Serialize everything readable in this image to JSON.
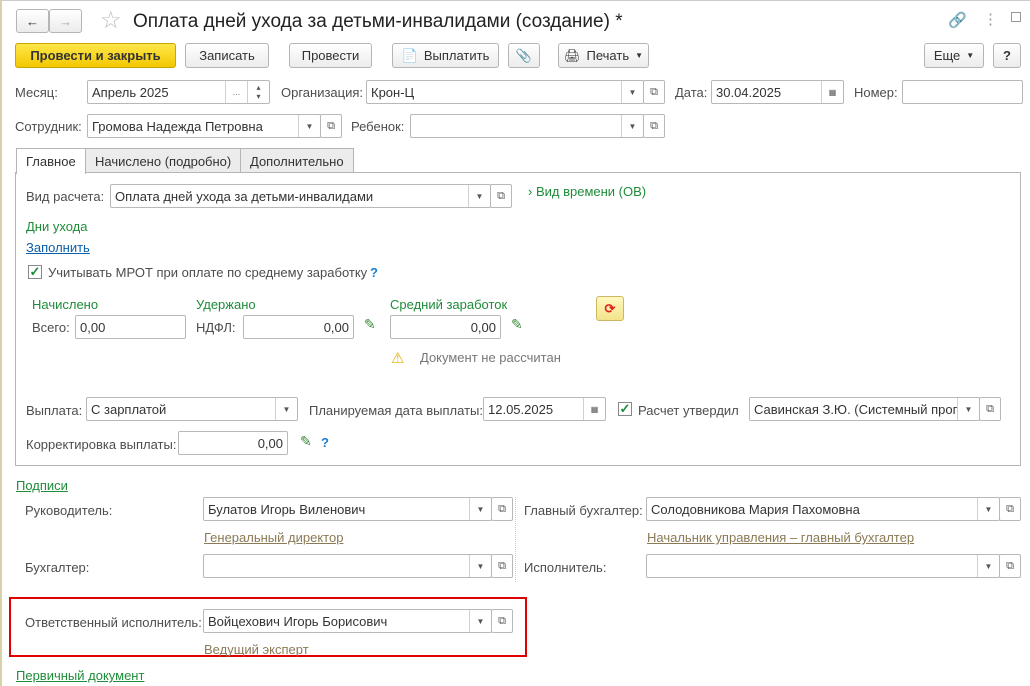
{
  "header": {
    "title": "Оплата дней ухода за детьми-инвалидами (создание) *"
  },
  "toolbar": {
    "post_close": "Провести и закрыть",
    "save": "Записать",
    "post": "Провести",
    "pay": "Выплатить",
    "print": "Печать",
    "more": "Еще",
    "help": "?"
  },
  "form": {
    "month_label": "Месяц:",
    "month_value": "Апрель 2025",
    "org_label": "Организация:",
    "org_value": "Крон-Ц",
    "date_label": "Дата:",
    "date_value": "30.04.2025",
    "number_label": "Номер:",
    "number_value": "",
    "employee_label": "Сотрудник:",
    "employee_value": "Громова Надежда Петровна",
    "child_label": "Ребенок:",
    "child_value": ""
  },
  "tabs": [
    {
      "label": "Главное"
    },
    {
      "label": "Начислено (подробно)"
    },
    {
      "label": "Дополнительно"
    }
  ],
  "main": {
    "calc_type_label": "Вид расчета:",
    "calc_type_value": "Оплата дней ухода за детьми-инвалидами",
    "time_type_link": "Вид времени (ОВ)",
    "care_days": "Дни ухода",
    "fill_link": "Заполнить",
    "mrot_label": "Учитывать МРОТ при оплате по среднему заработку",
    "mrot_help": "?",
    "accrued_header": "Начислено",
    "total_label": "Всего:",
    "total_value": "0,00",
    "withheld_header": "Удержано",
    "ndfl_label": "НДФЛ:",
    "ndfl_value": "0,00",
    "avg_header": "Средний заработок",
    "avg_value": "0,00",
    "warning": "Документ не рассчитан",
    "payout_label": "Выплата:",
    "payout_value": "С зарплатой",
    "plan_date_label": "Планируемая дата выплаты:",
    "plan_date_value": "12.05.2025",
    "approved_label": "Расчет утвердил",
    "approved_value": "Савинская З.Ю. (Системный прог",
    "correction_label": "Корректировка выплаты:",
    "correction_value": "0,00",
    "correction_help": "?"
  },
  "signatures": {
    "header": "Подписи",
    "head_label": "Руководитель:",
    "head_value": "Булатов Игорь Виленович",
    "head_position": "Генеральный директор",
    "chief_acc_label": "Главный бухгалтер:",
    "chief_acc_value": "Солодовникова Мария Пахомовна",
    "chief_acc_position": "Начальник управления – главный бухгалтер",
    "acc_label": "Бухгалтер:",
    "acc_value": "",
    "executor_label": "Исполнитель:",
    "executor_value": "",
    "resp_label": "Ответственный исполнитель:",
    "resp_value": "Войцехович Игорь Борисович",
    "resp_position": "Ведущий эксперт"
  },
  "footer": {
    "primary_doc": "Первичный документ"
  }
}
